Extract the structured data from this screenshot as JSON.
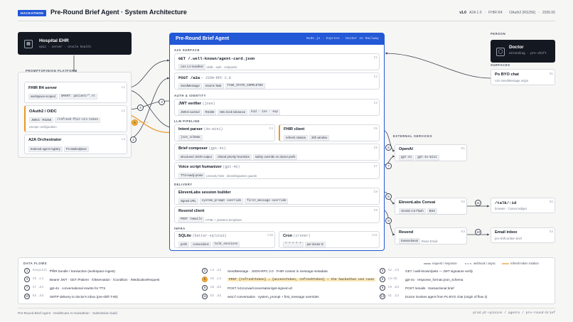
{
  "header": {
    "badge": "HACKATHON",
    "title": "Pre-Round Brief Agent · System Architecture",
    "version": "v1.0",
    "tags": [
      "A2A 1.0",
      "FHIR R4",
      "OAuth2 (RS256)",
      "2026.05"
    ]
  },
  "ehr": {
    "title": "Hospital EHR",
    "subtitle": "epic · cerner · oracle health",
    "icon": "building-icon"
  },
  "platform": {
    "label": "PROMPTOPINION PLATFORM",
    "items": [
      {
        "title": "FHIR R4 server",
        "id": "L1",
        "chips": [
          "workspace-scoped",
          "SMART: patient/*.rs"
        ]
      },
      {
        "title": "OAuth2 / OIDC",
        "id": "L2",
        "chips": [
          "JWKS · RS256",
          "/refresh-fhir-cts-token"
        ],
        "note": "oscope configuration"
      },
      {
        "title": "A2A Orchestrator",
        "id": "L3",
        "chips": [
          "External agent registry",
          "Po Marketplace"
        ]
      }
    ]
  },
  "agent": {
    "title": "Pre-Round Brief Agent",
    "stack": "Node.js · Express · Docker on Railway",
    "sections": [
      "A2A SURFACE",
      "AUTH & IDENTITY",
      "LLM PIPELINE",
      "DELIVERY",
      "INFRA"
    ],
    "surface": [
      {
        "title": "GET /.well-known/agent-card.json",
        "id": "C1",
        "chips": [
          "A2A 1.0 manifest"
        ],
        "note": "skills · auth · endpoints"
      },
      {
        "title": "POST /a2a",
        "sub": "— JSON-RPC 2.0",
        "id": "C2",
        "chips": [
          "SendMessage",
          "returns Task",
          "TASK_STATE_COMPLETED"
        ]
      }
    ],
    "auth": {
      "title": "JWT verifier",
      "sub": "(jose)",
      "id": "C3",
      "chips": [
        "JWKS-cached",
        "RS256",
        "60s clock tolerance",
        "kid · iss · exp"
      ]
    },
    "intent": {
      "title": "Intent parser",
      "sub": "(4o-mini)",
      "id": "C4",
      "chips": [
        "json_schema"
      ]
    },
    "fhirclient": {
      "title": "FHIR client",
      "id": "C5",
      "chips": [
        "refresh rotation",
        "30h window"
      ]
    },
    "composer": {
      "title": "Brief composer",
      "sub": "(gpt-4o)",
      "id": "C6",
      "chips": [
        "structured JSON output",
        "clinical priority heuristics",
        "safety override on doctor prefs"
      ]
    },
    "humanizer": {
      "title": "Voice script humanizer",
      "sub": "(gpt-4o)",
      "id": "C7",
      "chips": [
        "TTS-ready prose"
      ],
      "note": "prosody hints · disambiguation guards"
    },
    "elevenlabs": {
      "title": "ElevenLabs session builder",
      "id": "C8",
      "chips": [
        "signed URL",
        "system_prompt override",
        "first_message override"
      ]
    },
    "resend": {
      "title": "Resend client",
      "id": "C9",
      "chips": [
        "POST /emails"
      ],
      "note": "HTML + plaintext templates"
    },
    "sqlite": {
      "title": "SQLite",
      "sub": "(better-sqlite3)",
      "id": "C10",
      "chips": [
        "prefs",
        "connections",
        "talk_sessions"
      ]
    },
    "cron": {
      "title": "Cron",
      "sub": "(croner)",
      "id": "C11",
      "chips": [
        "* * * * *",
        "per-doctor tz"
      ]
    }
  },
  "person": {
    "label": "PERSON",
    "title": "Doctor",
    "subtitle": "attending · pre-shift",
    "icon": "user-icon",
    "surfaces_label": "SURFACES",
    "byo": {
      "title": "Po BYO chat",
      "id": "S1",
      "note": "A2A SendMessage origin"
    }
  },
  "external": {
    "label": "EXTERNAL SERVICES",
    "openai": {
      "title": "OpenAI",
      "id": "E1",
      "chips": [
        "gpt-4o",
        "gpt-4o-mini"
      ]
    },
    "convai": {
      "title": "ElevenLabs Convai",
      "id": "E2",
      "chips": [
        "Gemini 2.5 Flash",
        "BSS"
      ]
    },
    "resend": {
      "title": "Resend",
      "id": "E3",
      "chips": [
        "transactional"
      ],
      "note": "React Email"
    },
    "talk": {
      "title": "/talk/:id",
      "id": "S2",
      "note": "browser · Convai widget"
    },
    "inbox": {
      "title": "Email inbox",
      "id": "S3",
      "note": "pre-shift written brief"
    }
  },
  "legend": [
    "request / response",
    "webhook / async",
    "refresh-token rotation"
  ],
  "flows_label": "DATA FLOWS",
  "flows": [
    {
      "n": "1",
      "id": "Hospital →L1",
      "text": "FHIR bundle / transaction (workspace ingest)"
    },
    {
      "n": "2",
      "id": "L3 →C2",
      "text": "SendMessage · JSON-RPC 2.0 · FHIR context in message.metadata"
    },
    {
      "n": "3",
      "id": "C2 →C3",
      "text": "GET /.well-known/jwks — JWT signature verify"
    },
    {
      "n": "4",
      "id": "C5 →L1",
      "text": "Bearer JWT · GET /Patient · /Observation · /Condition · /MedicationRequest"
    },
    {
      "n": "5",
      "id": "C5 →L2",
      "text": "POST {refreshToken} → {accessToken, refreshToken} — the hackathon use case",
      "hl": true
    },
    {
      "n": "6",
      "id": "C4–C6",
      "text": "gpt-4o · response_format=json_schema"
    },
    {
      "n": "7",
      "id": "C7 →E1",
      "text": "gpt-4o · conversational rewrite for TTS"
    },
    {
      "n": "8",
      "id": "C8 →E2",
      "text": "POST /v1/convai/conversation/get-signed-url"
    },
    {
      "n": "9",
      "id": "C9 →E3",
      "text": "POST /emails · transactional brief"
    },
    {
      "n": "10",
      "id": "E3 →S3",
      "text": "SMTP delivery to doctor's inbox (pre-shift T-90)"
    },
    {
      "n": "11",
      "id": "E2 →S2",
      "text": "wss:// conversation · system_prompt + first_message overrides"
    },
    {
      "n": "12",
      "id": "S1 →C2",
      "text": "Doctor invokes agent from Po BYO chat (origin of flow 2)"
    }
  ],
  "footer": {
    "left": "Pre-Round Brief Agent · Healthcare AI Hackathon · Submission build",
    "right": "prod.pt-opinion / agents / pre-round-brief"
  },
  "colors": {
    "accent": "#2358d6",
    "orange": "#e8962a",
    "dark": "#141821"
  }
}
